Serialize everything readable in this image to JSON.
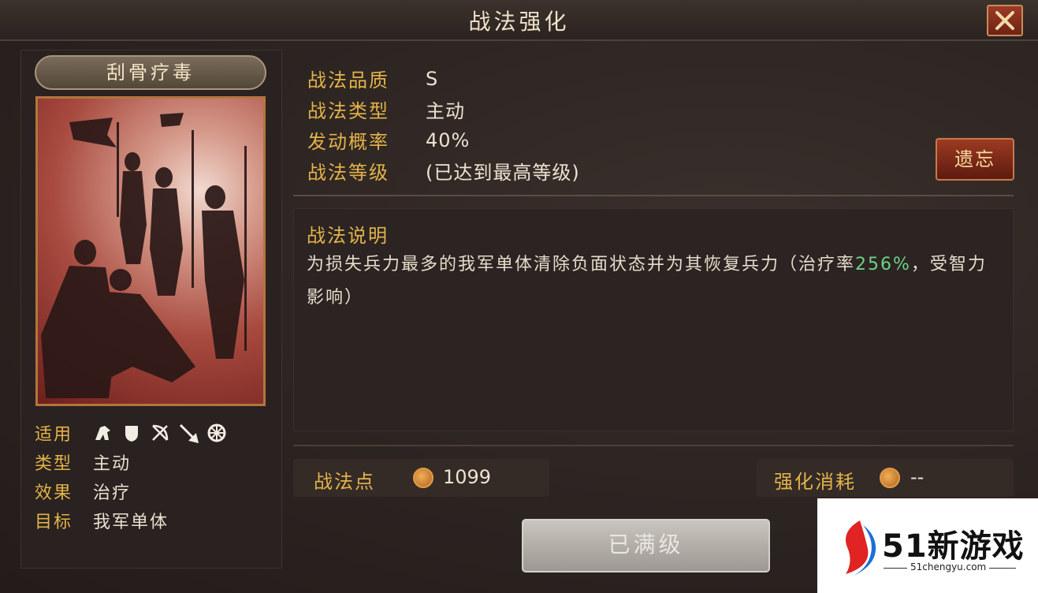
{
  "window": {
    "title": "战法强化",
    "close_icon": "close-x-icon"
  },
  "card": {
    "name": "刮骨疗毒",
    "attributes": {
      "applicable_label": "适用",
      "applicable_icons": [
        "cavalry-icon",
        "shield-icon",
        "bow-icon",
        "spear-icon",
        "chariot-wheel-icon"
      ],
      "type_label": "类型",
      "type_value": "主动",
      "effect_label": "效果",
      "effect_value": "治疗",
      "target_label": "目标",
      "target_value": "我军单体"
    }
  },
  "info": {
    "quality_label": "战法品质",
    "quality_value": "S",
    "type_label": "战法类型",
    "type_value": "主动",
    "chance_label": "发动概率",
    "chance_value": "40%",
    "level_label": "战法等级",
    "level_value": "(已达到最高等级)",
    "forget_button": "遗忘"
  },
  "description": {
    "title": "战法说明",
    "text_part1": "为损失兵力最多的我军单体清除负面状态并为其恢复兵力（治疗率",
    "highlight": "256%",
    "text_part2": "，受智力影响）"
  },
  "points": {
    "label": "战法点",
    "value": "1099"
  },
  "cost": {
    "label": "强化消耗",
    "value": "--"
  },
  "action_button": "已满级",
  "watermark": {
    "brand": "51新游戏",
    "url": "51chengyu.com"
  },
  "colors": {
    "accent_gold": "#e3b34a",
    "highlight_green": "#6fd08a",
    "button_red": "#9c3a22"
  }
}
